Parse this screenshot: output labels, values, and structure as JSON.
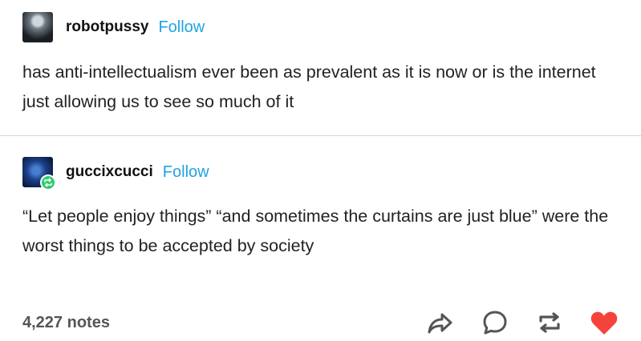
{
  "posts": [
    {
      "username": "robotpussy",
      "follow_label": "Follow",
      "text": "has anti-intellectualism ever been as prevalent as it is now or is the internet just allowing us to see so much of it"
    },
    {
      "username": "guccixcucci",
      "follow_label": "Follow",
      "text": "“Let people enjoy things” “and sometimes the curtains are just blue” were the worst things to be accepted by society"
    }
  ],
  "footer": {
    "notes": "4,227 notes",
    "actions": [
      "share-icon",
      "reply-icon",
      "reblog-icon",
      "like-icon"
    ]
  },
  "colors": {
    "follow": "#1fa3e4",
    "reblog_badge": "#2fca6d",
    "like": "#f5433b",
    "icon": "#555555"
  }
}
